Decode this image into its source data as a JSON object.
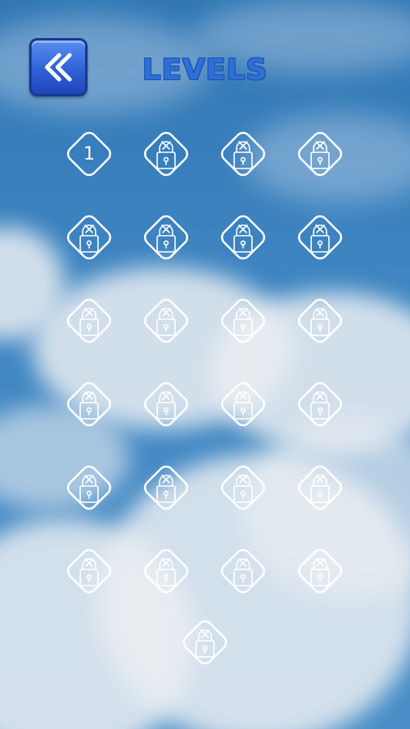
{
  "title": "LEVELS",
  "back_button": {
    "icon": "double-chevron-left-icon"
  },
  "levels": [
    {
      "number": "1",
      "locked": false
    },
    {
      "number": "",
      "locked": true
    },
    {
      "number": "",
      "locked": true
    },
    {
      "number": "",
      "locked": true
    },
    {
      "number": "",
      "locked": true
    },
    {
      "number": "",
      "locked": true
    },
    {
      "number": "",
      "locked": true
    },
    {
      "number": "",
      "locked": true
    },
    {
      "number": "",
      "locked": true
    },
    {
      "number": "",
      "locked": true
    },
    {
      "number": "",
      "locked": true
    },
    {
      "number": "",
      "locked": true
    },
    {
      "number": "",
      "locked": true
    },
    {
      "number": "",
      "locked": true
    },
    {
      "number": "",
      "locked": true
    },
    {
      "number": "",
      "locked": true
    },
    {
      "number": "",
      "locked": true
    },
    {
      "number": "",
      "locked": true
    },
    {
      "number": "",
      "locked": true
    },
    {
      "number": "",
      "locked": true
    },
    {
      "number": "",
      "locked": true
    },
    {
      "number": "",
      "locked": true
    },
    {
      "number": "",
      "locked": true
    },
    {
      "number": "",
      "locked": true
    },
    {
      "number": "",
      "locked": true
    }
  ],
  "colors": {
    "title": "#2d6fd8",
    "button": "#2f61d8",
    "tile_stroke": "#ffffff"
  },
  "lock_icon": "padlock-icon"
}
